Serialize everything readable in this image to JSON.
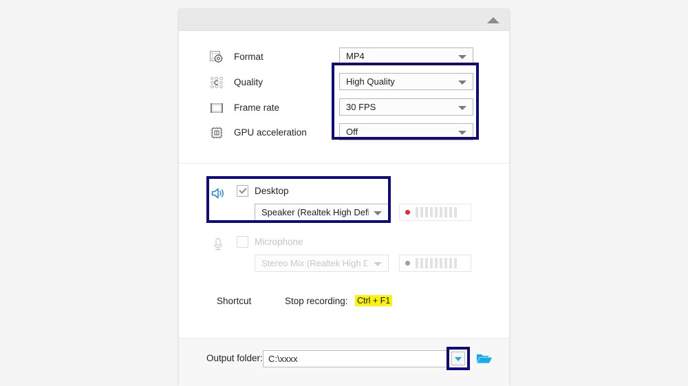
{
  "window": {
    "collapse_icon": "chevron-up-icon"
  },
  "video_settings": {
    "rows": [
      {
        "icon": "format-film-gear-icon",
        "label": "Format",
        "value": "MP4",
        "disabled": false
      },
      {
        "icon": "quality-dots-icon",
        "label": "Quality",
        "value": "High Quality",
        "disabled": false
      },
      {
        "icon": "frame-rate-icon",
        "label": "Frame rate",
        "value": "30 FPS",
        "disabled": false
      },
      {
        "icon": "gpu-chip-icon",
        "label": "GPU acceleration",
        "value": "Off",
        "disabled": false
      }
    ]
  },
  "audio": {
    "desktop": {
      "icon": "speaker-icon",
      "label": "Desktop",
      "checked": true,
      "device": "Speaker (Realtek High Defi...",
      "meter": {
        "state": "active",
        "bars": 9
      }
    },
    "microphone": {
      "icon": "microphone-icon",
      "label": "Microphone",
      "checked": false,
      "device": "Stereo Mix (Realtek High D...",
      "meter": {
        "state": "off",
        "bars": 9
      }
    }
  },
  "shortcut": {
    "section_label": "Shortcut",
    "action_label": "Stop recording:",
    "keys": "Ctrl + F1"
  },
  "output": {
    "label": "Output folder:",
    "path": "C:\\xxxx",
    "placeholder": "C:\\",
    "dropdown_icon": "chevron-down-icon",
    "browse_icon": "folder-open-icon"
  },
  "colors": {
    "highlight_border": "#100a7a",
    "accent_blue": "#16aaf0",
    "key_highlight": "#faf30a",
    "record_red": "#e02b2b"
  }
}
